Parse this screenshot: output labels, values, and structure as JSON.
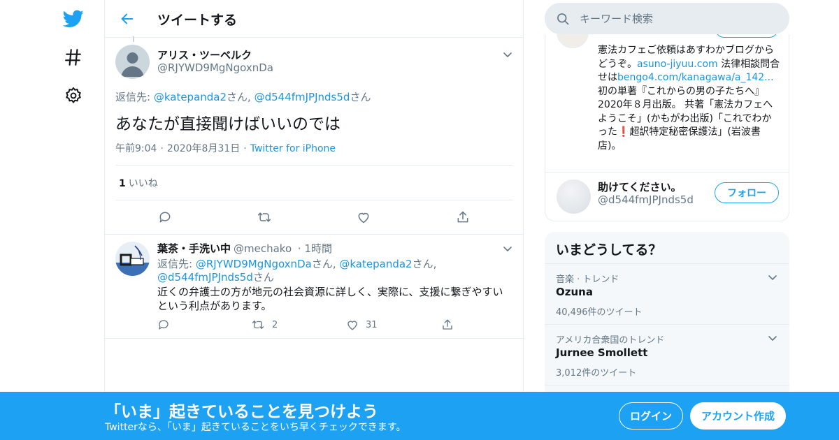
{
  "colors": {
    "accent": "#1da1f2",
    "text": "#14171a",
    "secondary": "#657786",
    "border": "#e6ecf0"
  },
  "nav": {
    "icons": [
      "twitter-bird-icon",
      "hashtag-icon",
      "gear-icon"
    ]
  },
  "header": {
    "title": "ツイートする"
  },
  "focus_tweet": {
    "name": "アリス・ツーベルク",
    "handle": "@RJYWD9MgNgoxnDa",
    "reply_to_prefix": "返信先: ",
    "reply_to": [
      "@katepanda2",
      "@d544fmJPJnds5d"
    ],
    "san": "さん",
    "comma": ", ",
    "text": "あなたが直接聞けばいいのでは",
    "time": "午前9:04",
    "date": "2020年8月31日",
    "source": "Twitter for iPhone",
    "like_count": "1",
    "like_label": "いいね"
  },
  "reply_tweet": {
    "name": "葉茶・手洗い中",
    "handle": "@mechako",
    "time": "· 1時間",
    "reply_to_prefix": "返信先: ",
    "reply_to": [
      "@RJYWD9MgNgoxnDa",
      "@katepanda2",
      "@d544fmJPJnds5d"
    ],
    "san": "さん",
    "comma": ", ",
    "text_line1": "近くの弁護士の方が地元の社会資源に詳しく、実際に、支援に繋ぎやすい",
    "text_line2": "という利点があります。",
    "retweets": "2",
    "likes": "31"
  },
  "search": {
    "placeholder": "キーワード検索"
  },
  "profile_card": {
    "bio_1": "憲法カフェご依頼はあすわかブログからどうぞ。",
    "bio_link1": "asuno-jiyuu.com",
    "bio_2": " 法律相談問合せは",
    "bio_link2": "bengo4.com/kanagawa/a_142...",
    "bio_3": " 初の単著『これからの男の子たちへ』2020年８月出版。 共著「憲法カフェへようこそ」(かもがわ出版)「これでわかった",
    "bio_emoji": "❗",
    "bio_4": "超訳特定秘密保護法」(岩波書店)。",
    "suggest_name": "助けてください。",
    "suggest_handle": "@d544fmJPJnds5d",
    "follow_label": "フォロー"
  },
  "trends": {
    "title": "いまどうしてる？",
    "items": [
      {
        "category": "音楽 · トレンド",
        "name": "Ozuna",
        "count": "40,496件のツイート"
      },
      {
        "category": "アメリカ合衆国のトレンド",
        "name": "Jurnee Smollett",
        "count": "3,012件のツイート"
      }
    ]
  },
  "banner": {
    "title": "「いま」起きていることを見つけよう",
    "subtitle": "Twitterなら、「いま」起きていることをいち早くチェックできます。",
    "login_label": "ログイン",
    "signup_label": "アカウント作成"
  }
}
